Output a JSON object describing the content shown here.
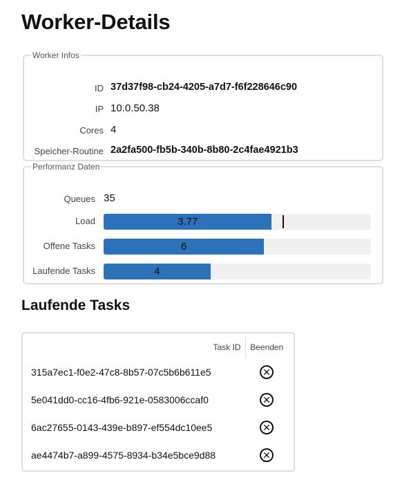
{
  "page": {
    "title": "Worker-Details"
  },
  "worker": {
    "legend": "Worker Infos",
    "id_label": "ID",
    "id": "37d37f98-cb24-4205-a7d7-f6f228646c90",
    "ip_label": "IP",
    "ip": "10.0.50.38",
    "cores_label": "Cores",
    "cores": "4",
    "storage_label": "Speicher-Routine",
    "storage": "2a2fa500-fb5b-340b-8b80-2c4fae4921b3"
  },
  "performance": {
    "legend": "Performanz Daten",
    "queues_label": "Queues",
    "queues": "35",
    "load_label": "Load",
    "load": "3.77",
    "load_fraction": 0.629,
    "load_marker_fraction": 0.67,
    "open_label": "Offene Tasks",
    "open": "6",
    "open_fraction": 0.6,
    "running_label": "Laufende Tasks",
    "running": "4",
    "running_fraction": 0.4,
    "bar_color": "#2d72b9"
  },
  "running_tasks": {
    "title": "Laufende Tasks",
    "col_id": "Task ID",
    "col_end": "Beenden",
    "rows": [
      {
        "id": "315a7ec1-f0e2-47c8-8b57-07c5b6b611e5",
        "end_icon": "close-circle-icon"
      },
      {
        "id": "5e041dd0-cc16-4fb6-921e-0583006ccaf0",
        "end_icon": "close-circle-icon"
      },
      {
        "id": "6ac27655-0143-439e-b897-ef554dc10ee5",
        "end_icon": "close-circle-icon"
      },
      {
        "id": "ae4474b7-a899-4575-8934-b34e5bce9d88",
        "end_icon": "close-circle-icon"
      }
    ]
  }
}
